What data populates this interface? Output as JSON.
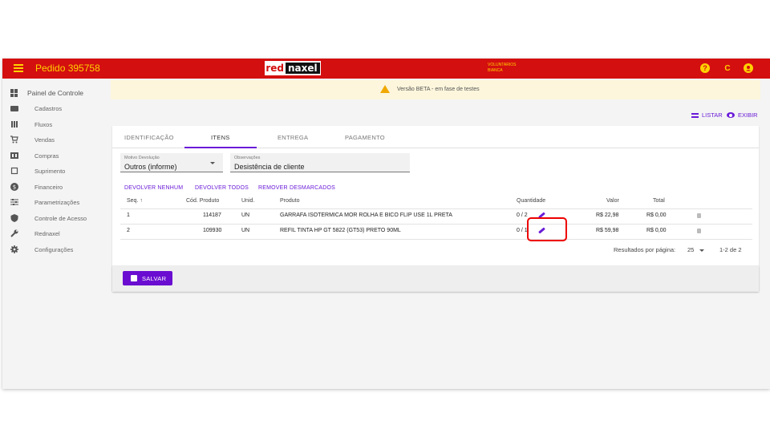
{
  "header": {
    "order_title": "Pedido 395758",
    "logo_red": "red",
    "logo_black": "naxel",
    "user_line1": "VOLUNTARIOS",
    "user_line2": "BIANCA",
    "help_icon": "?",
    "refresh_icon": "C",
    "account_icon": "●",
    "bar_color": "#d40f0f",
    "accent_color": "#ffd200"
  },
  "sidebar": {
    "title": "Painel de Controle",
    "items": [
      {
        "label": "Cadastros",
        "icon": "folder-icon"
      },
      {
        "label": "Fluxos",
        "icon": "columns-icon"
      },
      {
        "label": "Vendas",
        "icon": "cart-icon"
      },
      {
        "label": "Compras",
        "icon": "store-icon"
      },
      {
        "label": "Suprimento",
        "icon": "crop-icon"
      },
      {
        "label": "Financeiro",
        "icon": "money-icon"
      },
      {
        "label": "Parametrizações",
        "icon": "sliders-icon"
      },
      {
        "label": "Controle de Acesso",
        "icon": "shield-icon"
      },
      {
        "label": "Rednaxel",
        "icon": "wrench-icon"
      },
      {
        "label": "Configurações",
        "icon": "gear-icon"
      }
    ]
  },
  "banner": {
    "text": "Versão BETA - em fase de testes"
  },
  "view_actions": {
    "list_label": "LISTAR",
    "show_label": "EXIBIR"
  },
  "tabs": [
    {
      "label": "IDENTIFICAÇÃO"
    },
    {
      "label": "ITENS",
      "active": true
    },
    {
      "label": "ENTREGA"
    },
    {
      "label": "PAGAMENTO"
    }
  ],
  "form": {
    "reason_label": "Motivo Devolução",
    "reason_value": "Outros (informe)",
    "notes_label": "Observações",
    "notes_value": "Desistência de cliente"
  },
  "actions": {
    "return_none": "DEVOLVER NENHUM",
    "return_all": "DEVOLVER TODOS",
    "remove_unmarked": "REMOVER DESMARCADOS"
  },
  "table": {
    "headers": {
      "seq": "Seq.",
      "seq_sort": "↑",
      "code": "Cód. Produto",
      "unit": "Unid.",
      "product": "Produto",
      "qty": "Quantidade",
      "value": "Valor",
      "total": "Total"
    },
    "rows": [
      {
        "seq": "1",
        "code": "114187",
        "unit": "UN",
        "product": "GARRAFA ISOTERMICA MOR ROLHA E BICO FLIP USE 1L PRETA",
        "qty": "0 / 2",
        "value": "R$ 22,98",
        "total": "R$ 0,00"
      },
      {
        "seq": "2",
        "code": "109930",
        "unit": "UN",
        "product": "REFIL TINTA HP GT 5822 (GT53) PRETO 90ML",
        "qty": "0 / 1",
        "value": "R$ 59,98",
        "total": "R$ 0,00"
      }
    ]
  },
  "pagination": {
    "per_page_label": "Resultados por página:",
    "per_page_value": "25",
    "range": "1-2 de 2"
  },
  "footer": {
    "save_label": "SALVAR"
  }
}
